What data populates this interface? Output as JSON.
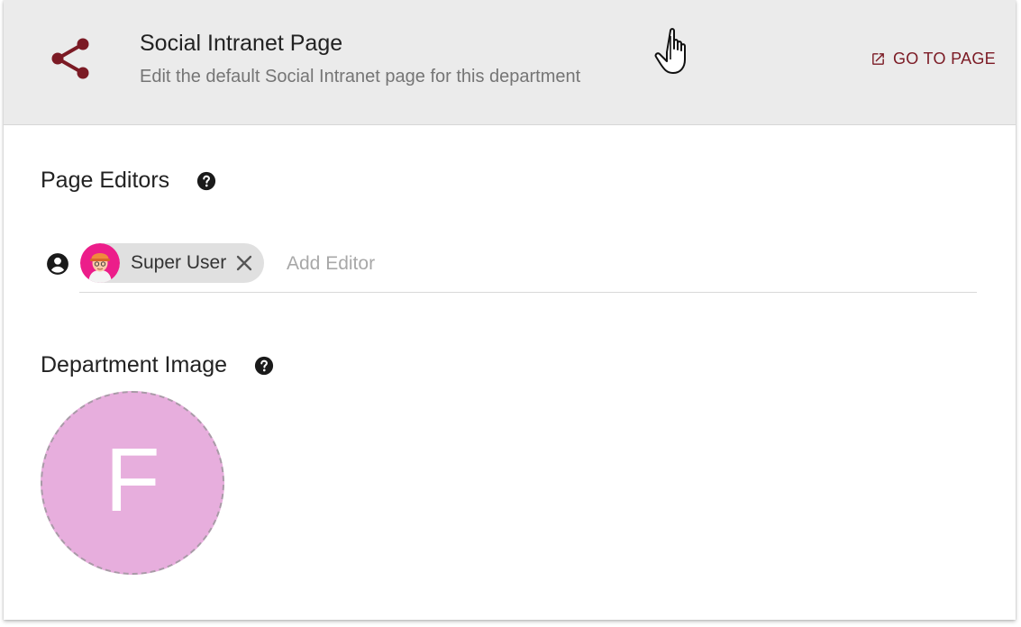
{
  "header": {
    "icon": "share-icon",
    "title": "Social Intranet Page",
    "subtitle": "Edit the default Social Intranet page for this department",
    "go_to_page_label": "GO TO PAGE",
    "go_to_page_icon": "open-in-new-icon"
  },
  "page_editors": {
    "title": "Page Editors",
    "help_icon": "help-circle-icon",
    "leading_icon": "account-circle-icon",
    "editors": [
      {
        "name": "Super User",
        "avatar": "user-avatar",
        "remove_icon": "close-icon"
      }
    ],
    "input": {
      "value": "",
      "placeholder": "Add Editor"
    }
  },
  "department_image": {
    "title": "Department Image",
    "help_icon": "help-circle-icon",
    "placeholder_letter": "F"
  },
  "colors": {
    "accent": "#7b1a24",
    "header_bg": "#ebebeb",
    "image_bg": "#e7aedd"
  }
}
